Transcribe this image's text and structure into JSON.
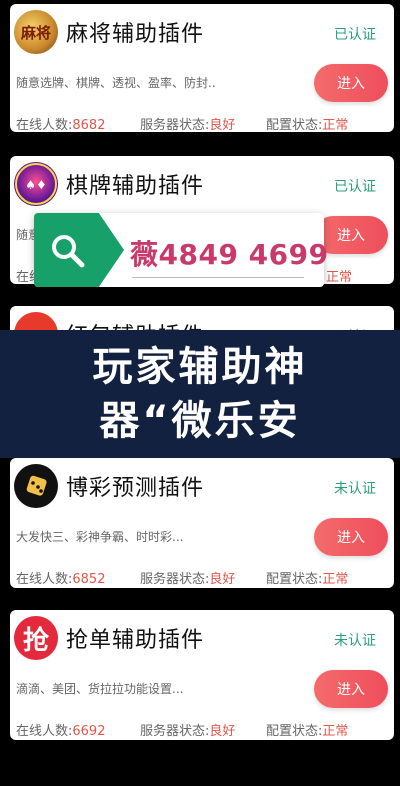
{
  "cards": [
    {
      "logo_text": "麻将",
      "title": "麻将辅助插件",
      "status": "已认证",
      "description": "随意选牌、棋牌、透视、盈率、防封..",
      "button": "进入",
      "online_label": "在线人数:",
      "online_value": "8682",
      "server_label": "服务器状态:",
      "server_value": "良好",
      "config_label": "配置状态:",
      "config_value": "正常"
    },
    {
      "logo_text": "",
      "title": "棋牌辅助插件",
      "status": "已认证",
      "description": "随意",
      "button": "进入",
      "online_label": "在线",
      "online_value": "",
      "server_label": "",
      "server_value": "",
      "config_label": "",
      "config_value": "正常"
    },
    {
      "logo_text": "",
      "title": "红包辅助插件",
      "status": "已认证"
    },
    {
      "logo_text": "",
      "title": "博彩预测插件",
      "status": "未认证",
      "description": "大发快三、彩神争霸、时时彩...",
      "button": "进入",
      "online_label": "在线人数:",
      "online_value": "6852",
      "server_label": "服务器状态:",
      "server_value": "良好",
      "config_label": "配置状态:",
      "config_value": "正常"
    },
    {
      "logo_text": "抢",
      "title": "抢单辅助插件",
      "status": "未认证",
      "description": "滴滴、美团、货拉拉功能设置...",
      "button": "进入",
      "online_label": "在线人数:",
      "online_value": "6692",
      "server_label": "服务器状态:",
      "server_value": "良好",
      "config_label": "配置状态:",
      "config_value": "正常"
    }
  ],
  "search_overlay": {
    "text": "薇4849 4699",
    "icon": "search-icon"
  },
  "title_band": {
    "line1": "玩家辅助神",
    "line2": "器“微乐安"
  },
  "colors": {
    "verified": "#2aa07a",
    "value_red": "#e0584b",
    "button": "#ee4e5c",
    "search_tab": "#17a06a",
    "band": "#12213f"
  }
}
